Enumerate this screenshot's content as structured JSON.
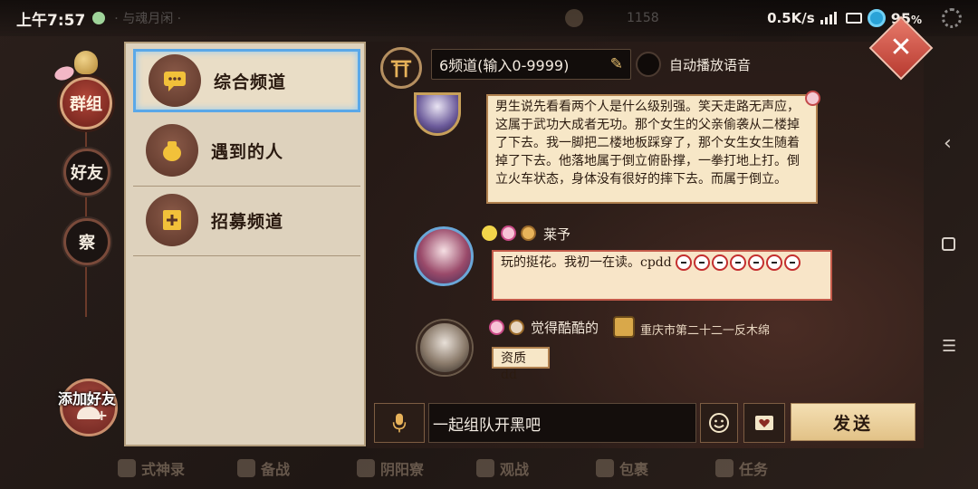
{
  "status_bar": {
    "time": "上午7:57",
    "bg_title": "· 与魂月闲 ·",
    "bg_count": "1158",
    "network_speed": "0.5K/s",
    "battery": "95",
    "battery_unit": "%"
  },
  "rail": {
    "group_label": "群组",
    "friends_label": "好友",
    "observe_label": "察",
    "add_friend_label": "添加好友"
  },
  "channels": [
    {
      "label": "综合频道",
      "icon": "chat-bubble-icon",
      "selected": true
    },
    {
      "label": "遇到的人",
      "icon": "bag-icon",
      "selected": false
    },
    {
      "label": "招募频道",
      "icon": "recruit-banner-icon",
      "selected": false
    }
  ],
  "chat_header": {
    "channel_value": "6频道(输入0-9999)",
    "auto_voice_label": "自动播放语音"
  },
  "messages": [
    {
      "text": "男生说先看看两个人是什么级别强。笑天走路无声应，这属于武功大成者无功。那个女生的父亲偷袭从二楼掉了下去。我一脚把二楼地板踩穿了，那个女生女生随着掉了下去。他落地属于倒立俯卧撑，一拳打地上打。倒立火车状态，身体没有很好的摔下去。而属于倒立。"
    },
    {
      "name": "莱予",
      "text": "玩的挺花。我初一在读。cpdd"
    },
    {
      "name": "觉得酷酷的",
      "location": "重庆市第二十二一反木绵",
      "text": "资质dd"
    }
  ],
  "input_bar": {
    "message_value": "一起组队开黑吧",
    "send_label": "发送"
  },
  "bottom_nav": [
    "式神录",
    "备战",
    "阴阳寮",
    "观战",
    "包裹",
    "任务"
  ],
  "colors": {
    "panel_bg": "#ded2bd",
    "selected_border": "#5aa8e8",
    "accent_red": "#b2473a",
    "send_button": "#e9cf9c"
  }
}
